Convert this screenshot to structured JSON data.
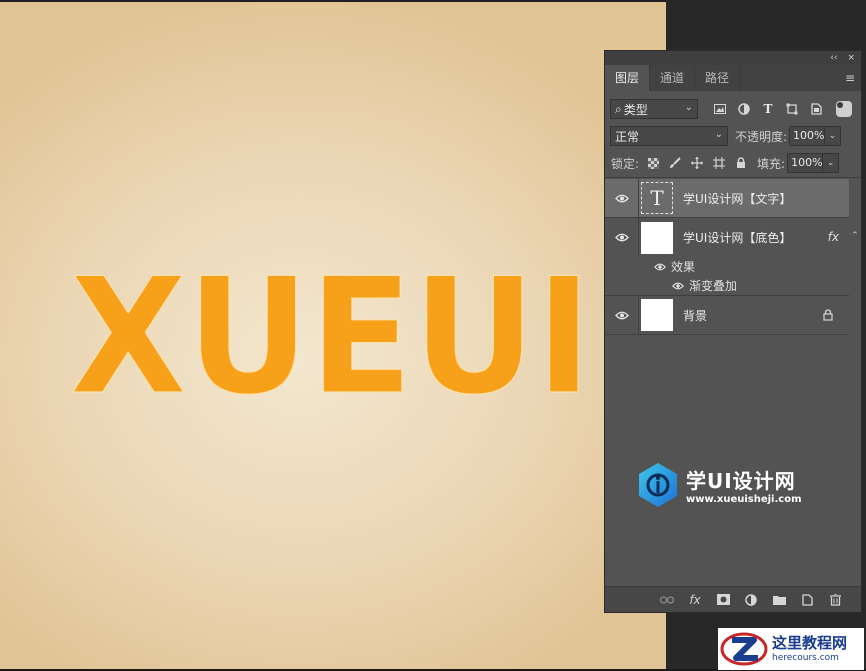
{
  "canvas": {
    "artwork_text": "XUEUI",
    "text_color": "#f7a11a",
    "background_colors": [
      "#f3e7cf",
      "#e2c597"
    ]
  },
  "panel": {
    "topbar": {
      "collapse_glyph": "‹‹",
      "close_glyph": "×"
    },
    "tabs": [
      {
        "label": "图层",
        "active": true
      },
      {
        "label": "通道",
        "active": false
      },
      {
        "label": "路径",
        "active": false
      }
    ],
    "menu_glyph": "≡",
    "filter": {
      "search_glyph": "⌕",
      "value": "类型",
      "icons": [
        "image-filter-icon",
        "adjustment-filter-icon",
        "type-filter-icon",
        "shape-filter-icon",
        "smart-object-filter-icon"
      ]
    },
    "blend": {
      "mode": "正常",
      "opacity_label": "不透明度:",
      "opacity_value": "100%"
    },
    "lock": {
      "label": "锁定:",
      "fill_label": "填充:",
      "fill_value": "100%"
    },
    "layers": [
      {
        "name": "学UI设计网【文字】",
        "type": "text",
        "thumb_glyph": "T",
        "selected": true
      },
      {
        "name": "学UI设计网【底色】",
        "type": "fill",
        "fx": "fx",
        "effects_label": "效果",
        "effect_items": [
          "渐变叠加"
        ]
      },
      {
        "name": "背景",
        "type": "background",
        "locked": true
      }
    ],
    "bottom_icons": [
      "link-layers-icon",
      "fx-icon",
      "mask-icon",
      "adjustment-layer-icon",
      "group-folder-icon",
      "new-layer-icon",
      "delete-icon"
    ],
    "bottom_fx": "fx"
  },
  "watermark": {
    "title": "学UI设计网",
    "url": "www.xueuisheji.com"
  },
  "corner_logo": {
    "title": "这里教程网",
    "url": "herecours.com"
  }
}
